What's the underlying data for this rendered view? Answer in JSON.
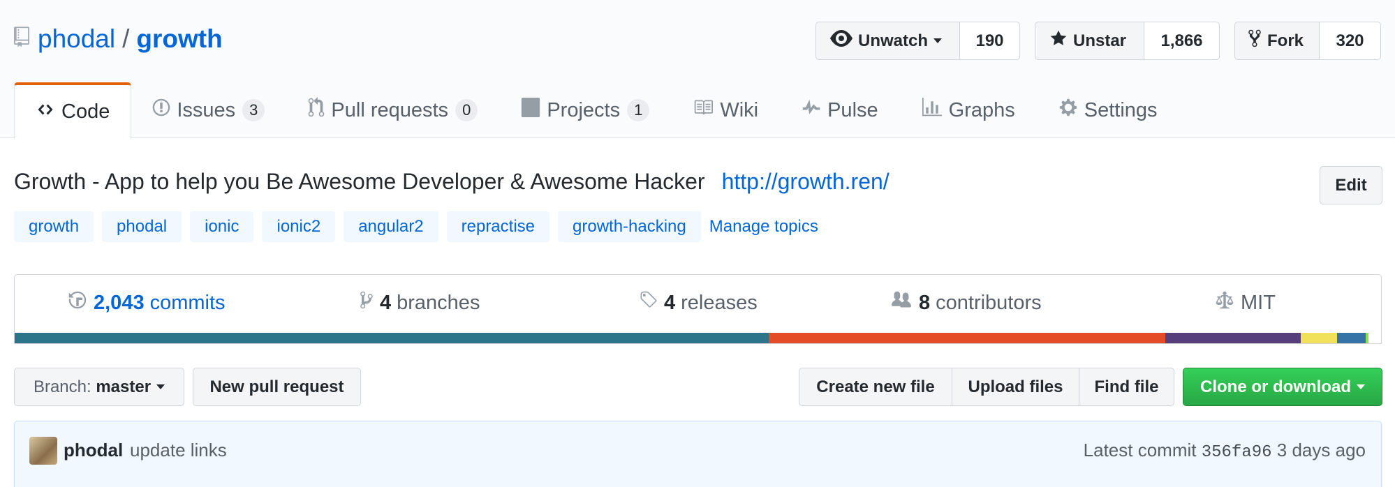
{
  "repo": {
    "owner": "phodal",
    "separator": "/",
    "name": "growth"
  },
  "actions": {
    "watch": {
      "label": "Unwatch",
      "count": "190"
    },
    "star": {
      "label": "Unstar",
      "count": "1,866"
    },
    "fork": {
      "label": "Fork",
      "count": "320"
    }
  },
  "tabs": [
    {
      "label": "Code",
      "icon": "code-icon",
      "selected": true
    },
    {
      "label": "Issues",
      "count": "3",
      "icon": "issue-icon"
    },
    {
      "label": "Pull requests",
      "count": "0",
      "icon": "pull-request-icon"
    },
    {
      "label": "Projects",
      "count": "1",
      "icon": "project-icon"
    },
    {
      "label": "Wiki",
      "icon": "book-icon"
    },
    {
      "label": "Pulse",
      "icon": "pulse-icon"
    },
    {
      "label": "Graphs",
      "icon": "graph-icon"
    },
    {
      "label": "Settings",
      "icon": "gear-icon"
    }
  ],
  "description": {
    "text": "Growth - App to help you Be Awesome Developer & Awesome Hacker",
    "url": "http://growth.ren/",
    "edit_label": "Edit"
  },
  "topics": [
    "growth",
    "phodal",
    "ionic",
    "ionic2",
    "angular2",
    "repractise",
    "growth-hacking"
  ],
  "manage_topics": "Manage topics",
  "summary": {
    "commits": {
      "num": "2,043",
      "label": "commits"
    },
    "branches": {
      "num": "4",
      "label": "branches"
    },
    "releases": {
      "num": "4",
      "label": "releases"
    },
    "contributors": {
      "num": "8",
      "label": "contributors"
    },
    "license": "MIT"
  },
  "languages": [
    {
      "color": "#2b7489",
      "share": 55.2
    },
    {
      "color": "#e34c26",
      "share": 29.0
    },
    {
      "color": "#563d7c",
      "share": 9.9
    },
    {
      "color": "#f1e05a",
      "share": 2.7
    },
    {
      "color": "#3572A5",
      "share": 2.1
    },
    {
      "color": "#89e051",
      "share": 0.2
    }
  ],
  "toolbar": {
    "branch_prefix": "Branch:",
    "branch": "master",
    "new_pr": "New pull request",
    "create_file": "Create new file",
    "upload_files": "Upload files",
    "find_file": "Find file",
    "clone": "Clone or download"
  },
  "commit": {
    "author": "phodal",
    "message": "update links",
    "latest_label": "Latest commit",
    "sha": "356fa96",
    "time": "3 days ago"
  }
}
